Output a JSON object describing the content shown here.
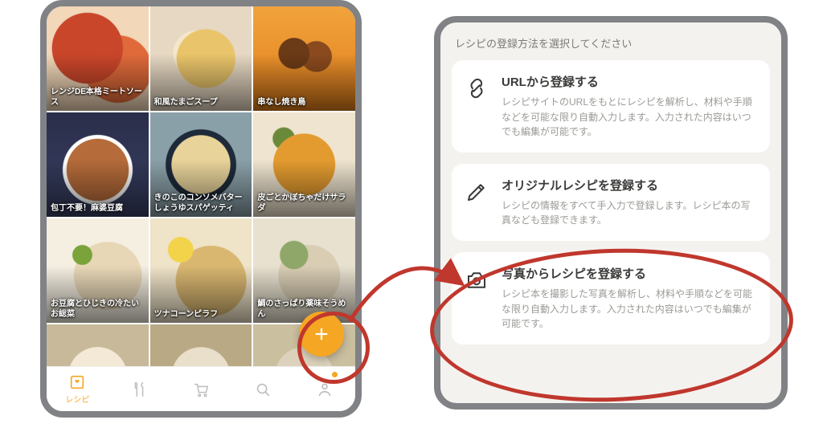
{
  "leftApp": {
    "recipes": [
      {
        "title": "レンジDE本格ミートソース"
      },
      {
        "title": "和風たまごスープ"
      },
      {
        "title": "串なし焼き鳥"
      },
      {
        "title": "包丁不要！麻婆豆腐"
      },
      {
        "title": "きのこのコンソメバターしょうゆスパゲッティ"
      },
      {
        "title": "皮ごとかぼちゃだけサラダ"
      },
      {
        "title": "お豆腐とひじきの冷たいお総菜"
      },
      {
        "title": "ツナコーンピラフ"
      },
      {
        "title": "鯛のさっぱり薬味そうめん"
      },
      {
        "title": ""
      },
      {
        "title": ""
      },
      {
        "title": ""
      }
    ],
    "tabs": {
      "recipe": "レシピ",
      "plan": "",
      "cart": "",
      "search": "",
      "profile": ""
    },
    "fab_icon": "plus-icon"
  },
  "sheet": {
    "heading": "レシピの登録方法を選択してください",
    "options": [
      {
        "icon": "link-icon",
        "title": "URLから登録する",
        "desc": "レシピサイトのURLをもとにレシピを解析し、材料や手順などを可能な限り自動入力します。入力された内容はいつでも編集が可能です。"
      },
      {
        "icon": "pencil-icon",
        "title": "オリジナルレシピを登録する",
        "desc": "レシピの情報をすべて手入力で登録します。レシピ本の写真なども登録できます。"
      },
      {
        "icon": "camera-icon",
        "title": "写真からレシピを登録する",
        "desc": "レシピ本を撮影した写真を解析し、材料や手順などを可能な限り自動入力します。入力された内容はいつでも編集が可能です。"
      }
    ]
  },
  "colors": {
    "accent": "#f5a623",
    "annotation": "#c0372d",
    "frame": "#808285"
  }
}
